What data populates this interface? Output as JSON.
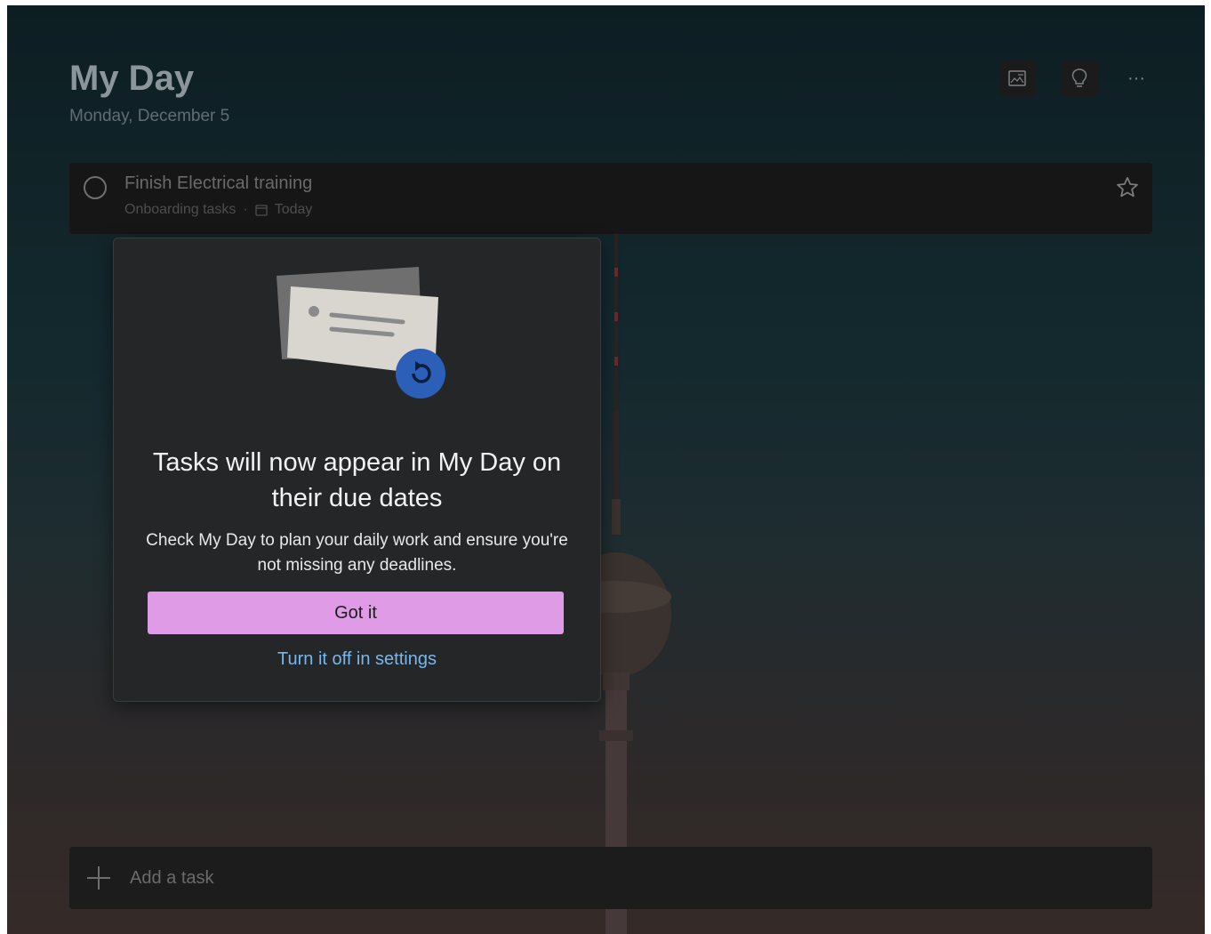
{
  "header": {
    "title": "My Day",
    "date": "Monday, December 5"
  },
  "toolbar": {
    "icons": [
      "background-icon",
      "lightbulb-icon",
      "more-icon"
    ],
    "more_label": "···"
  },
  "task": {
    "title": "Finish Electrical training",
    "list": "Onboarding tasks",
    "separator": "·",
    "due": "Today"
  },
  "popup": {
    "heading": "Tasks will now appear in My Day on their due dates",
    "body": "Check My Day to plan your daily work and ensure you're not missing any deadlines.",
    "primary_button": "Got it",
    "link": "Turn it off in settings"
  },
  "add_task": {
    "placeholder": "Add a task"
  },
  "colors": {
    "accent_button": "#df9be6",
    "link": "#78b7ee",
    "illustration_badge": "#2f5db3"
  }
}
